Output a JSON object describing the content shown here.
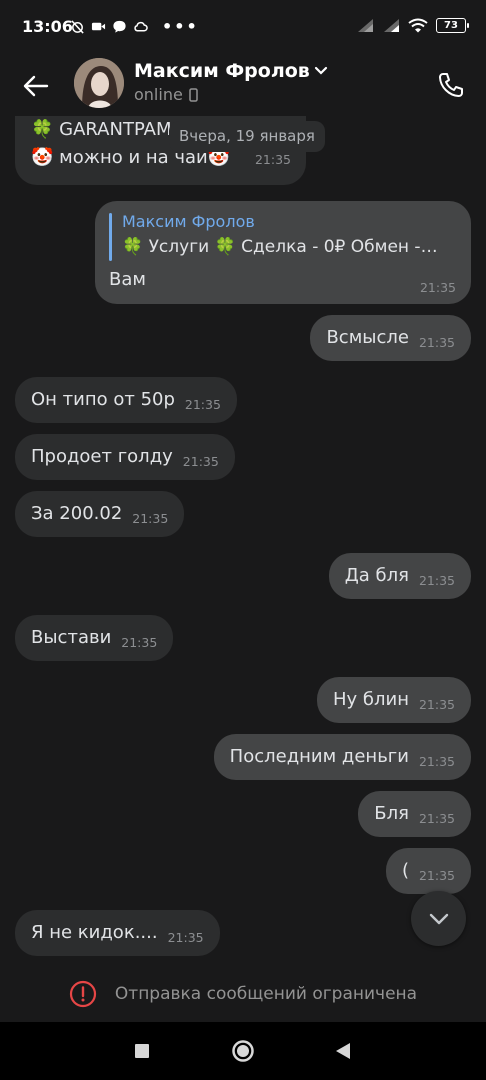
{
  "status_bar": {
    "time": "13:06",
    "battery": "73",
    "more_dots": "•••"
  },
  "header": {
    "contact_name": "Максим Фролов",
    "status": "online",
    "icons": [
      "back-arrow-icon",
      "chevron-down-icon",
      "phone-icon",
      "mobile-device-icon"
    ]
  },
  "date_separator": "Вчера, 19 января",
  "first_message": {
    "line1": "🍀 GARANTPAM",
    "line2": "🤡 можно и на чай🤡",
    "time": "21:35"
  },
  "reply_message": {
    "quote_author": "Максим Фролов",
    "quote_text": "🍀 Услуги 🍀 Сделка - 0₽ Обмен - ...",
    "text": "Вам",
    "time": "21:35"
  },
  "messages": [
    {
      "text": "Всмысле",
      "time": "21:35",
      "direction": "out"
    },
    {
      "text": "Он типо от 50р",
      "time": "21:35",
      "direction": "in"
    },
    {
      "text": "Продоет голду",
      "time": "21:35",
      "direction": "in"
    },
    {
      "text": "За 200.02",
      "time": "21:35",
      "direction": "in"
    },
    {
      "text": "Да бля",
      "time": "21:35",
      "direction": "out"
    },
    {
      "text": "Выстави",
      "time": "21:35",
      "direction": "in"
    },
    {
      "text": "Ну блин",
      "time": "21:35",
      "direction": "out"
    },
    {
      "text": "Последним деньги",
      "time": "21:35",
      "direction": "out"
    },
    {
      "text": "Бля",
      "time": "21:35",
      "direction": "out"
    },
    {
      "text": "(",
      "time": "21:35",
      "direction": "out"
    },
    {
      "text": "Я не кидок....",
      "time": "21:35",
      "direction": "in"
    }
  ],
  "restriction_notice": "Отправка сообщений ограничена",
  "colors": {
    "background": "#19191a",
    "incoming_bubble": "#2c2d2e",
    "outgoing_bubble": "#444546",
    "accent": "#71aaeb",
    "warning": "#e64646"
  }
}
